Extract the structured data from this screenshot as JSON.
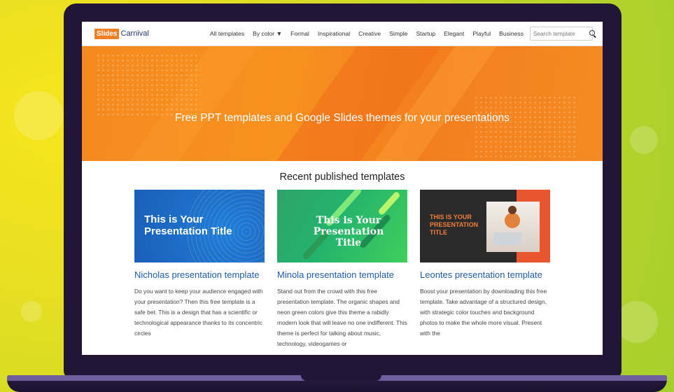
{
  "nav": {
    "logo_box": "Slides",
    "logo_text": "Carnival",
    "menu": [
      "All templates",
      "By color",
      "Formal",
      "Inspirational",
      "Creative",
      "Simple",
      "Startup",
      "Elegant",
      "Playful",
      "Business"
    ],
    "search_placeholder": "Search template"
  },
  "hero": {
    "title": "Free PPT templates and Google Slides themes for your presentations"
  },
  "recent": {
    "heading": "Recent published templates",
    "cards": [
      {
        "thumb_title": "This is Your Presentation Title",
        "title": "Nicholas presentation template",
        "desc": "Do you want to keep your audience engaged with your presentation? Then this free template is a safe bet. This is a design that has a scientific or technological appearance thanks to its concentric circles"
      },
      {
        "thumb_title": "This is Your Presentation Title",
        "title": "Minola presentation template",
        "desc": "Stand out from the crowd with this free presentation template. The organic shapes and neon green colors give this theme a rabidly modern look that will leave no one indifferent. This theme is perfect for talking about music, technology, videogames or"
      },
      {
        "thumb_title": "THIS IS YOUR PRESENTATION TITLE",
        "title": "Leontes presentation template",
        "desc": "Boost your presentation by downloading this free template. Take advantage of a structured design, with strategic color touches and background photos to make the whole more visual. Present with the"
      }
    ]
  },
  "colors": {
    "accent": "#f7911f",
    "link": "#1f5ca8",
    "bezel": "#221535",
    "background": "#c8d827"
  }
}
